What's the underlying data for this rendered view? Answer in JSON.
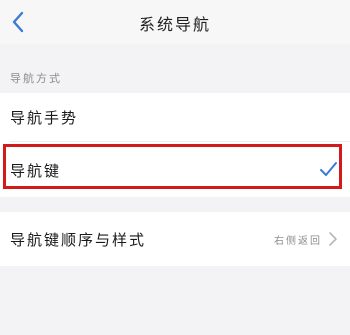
{
  "header": {
    "title": "系统导航"
  },
  "section": {
    "label": "导航方式"
  },
  "options": {
    "gestures": "导航手势",
    "keys": "导航键"
  },
  "order_style": {
    "label": "导航键顺序与样式",
    "value": "右侧返回"
  },
  "colors": {
    "accent": "#3a7bd5",
    "highlight": "#d11a1a"
  },
  "icons": {
    "back": "chevron-left-icon",
    "selected": "check-icon",
    "more": "chevron-right-icon"
  }
}
